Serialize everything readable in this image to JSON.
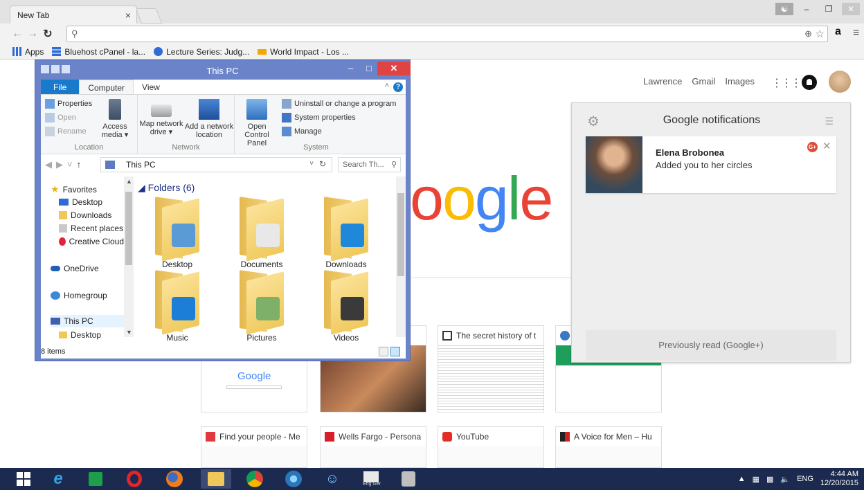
{
  "browser": {
    "tab_title": "New Tab",
    "tab_close": "×",
    "bookmarks": [
      {
        "label": "Apps",
        "icon": "apps-grid-icon",
        "color": "#2f6bd6"
      },
      {
        "label": "Bluehost cPanel - la...",
        "icon": "bluehost-icon",
        "color": "#2f6bd6"
      },
      {
        "label": "Lecture Series: Judg...",
        "icon": "globe-icon",
        "color": "#2f6bd6"
      },
      {
        "label": "World Impact - Los ...",
        "icon": "wi-icon",
        "color": "#f2a900"
      }
    ]
  },
  "google": {
    "links": [
      "Lawrence",
      "Gmail",
      "Images"
    ],
    "logo_partial": "oogle",
    "logo_colors": [
      "#4285f4",
      "#ea4335",
      "#fbbc05",
      "#4285f4",
      "#34a853",
      "#ea4335"
    ],
    "tiles": [
      {
        "title": "",
        "icon": "google-icon",
        "thumb_text": "Google"
      },
      {
        "title": "",
        "icon": "person-icon",
        "thumb_text": ""
      },
      {
        "title": "The secret history of t",
        "icon": "grid-icon",
        "thumb_text": ""
      },
      {
        "title": "",
        "icon": "globe-icon",
        "thumb_text": ""
      },
      {
        "title": "Find your people - Me",
        "icon": "meetup-icon",
        "thumb_text": ""
      },
      {
        "title": "Wells Fargo - Persona",
        "icon": "wellsfargo-icon",
        "thumb_text": ""
      },
      {
        "title": "YouTube",
        "icon": "youtube-icon",
        "thumb_text": ""
      },
      {
        "title": "A Voice for Men – Hu",
        "icon": "avfm-icon",
        "thumb_text": ""
      }
    ]
  },
  "notifications": {
    "title": "Google notifications",
    "items": [
      {
        "name": "Elena Brobonea",
        "message": "Added you to her circles",
        "badge": "G+"
      }
    ],
    "footer": "Previously read (Google+)"
  },
  "explorer": {
    "title": "This PC",
    "tabs": [
      "File",
      "Computer",
      "View"
    ],
    "ribbon": {
      "location": {
        "label": "Location",
        "items": [
          "Properties",
          "Open",
          "Rename"
        ],
        "big": "Access media ▾"
      },
      "network": {
        "label": "Network",
        "items": [
          "Map network drive ▾",
          "Add a network location"
        ]
      },
      "system": {
        "label": "System",
        "big": "Open Control Panel",
        "items": [
          "Uninstall or change a program",
          "System properties",
          "Manage"
        ]
      }
    },
    "address": "This PC",
    "search_placeholder": "Search Th...",
    "nav": [
      {
        "label": "Favorites",
        "icon": "star-icon"
      },
      {
        "label": "Desktop",
        "icon": "desktop-icon"
      },
      {
        "label": "Downloads",
        "icon": "downloads-icon"
      },
      {
        "label": "Recent places",
        "icon": "recent-places-icon"
      },
      {
        "label": "Creative Cloud",
        "icon": "creative-cloud-icon"
      },
      {
        "label": "OneDrive",
        "icon": "onedrive-icon"
      },
      {
        "label": "Homegroup",
        "icon": "homegroup-icon"
      },
      {
        "label": "This PC",
        "icon": "this-pc-icon"
      },
      {
        "label": "Desktop",
        "icon": "desktop-icon"
      }
    ],
    "section": "Folders (6)",
    "folders": [
      {
        "label": "Desktop",
        "badge": "#5b9bd5"
      },
      {
        "label": "Documents",
        "badge": "#e8e8e8"
      },
      {
        "label": "Downloads",
        "badge": "#1f88d9"
      },
      {
        "label": "Music",
        "badge": "#1c7ed6"
      },
      {
        "label": "Pictures",
        "badge": "#7fb069"
      },
      {
        "label": "Videos",
        "badge": "#3a3a3a"
      }
    ],
    "status": "8 items"
  },
  "taskbar": {
    "apps": [
      "start-icon",
      "ie-icon",
      "store-icon",
      "opera-icon",
      "firefox-icon",
      "file-explorer-icon",
      "chrome-icon",
      "app-icon",
      "people-icon",
      "dictionary-icon",
      "speech-icon"
    ],
    "dict_label": "Eng Ger",
    "lang": "ENG",
    "time": "4:44 AM",
    "date": "12/20/2015"
  }
}
